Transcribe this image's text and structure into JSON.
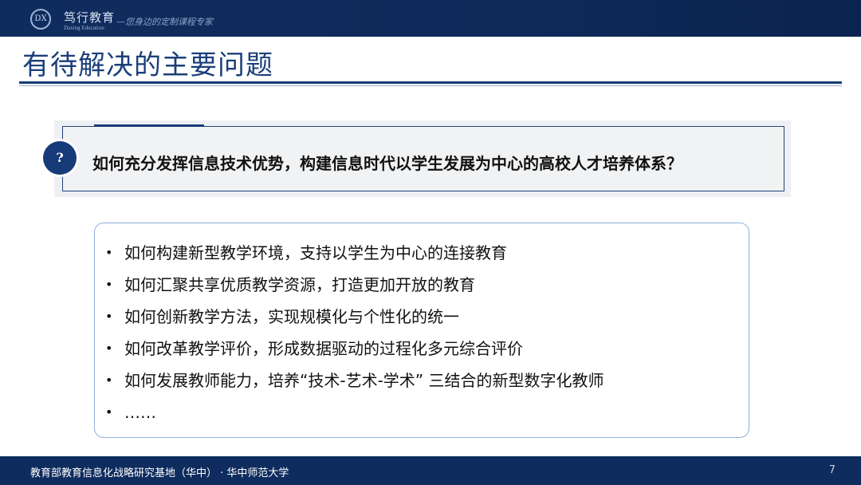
{
  "header": {
    "logo_mark": "DX",
    "brand_name": "笃行教育",
    "brand_english": "Daxing Education",
    "slogan": "—您身边的定制课程专家"
  },
  "slide": {
    "title": "有待解决的主要问题",
    "question_badge": "?",
    "question": "如何充分发挥信息技术优势，构建信息时代以学生发展为中心的高校人才培养体系？",
    "bullet_symbol": "•",
    "items": [
      "如何构建新型教学环境，支持以学生为中心的连接教育",
      "如何汇聚共享优质教学资源，打造更加开放的教育",
      "如何创新教学方法，实现规模化与个性化的统一",
      "如何改革教学评价，形成数据驱动的过程化多元综合评价",
      "如何发展教师能力，培养“技术-艺术-学术”  三结合的新型数字化教师",
      "……"
    ]
  },
  "footer": {
    "text": "教育部教育信息化战略研究基地（华中）  ·   华中师范大学",
    "page_number": "7"
  },
  "colors": {
    "navy": "#0f2c5e",
    "title_blue": "#1b3f7a",
    "list_border": "#8fb0da"
  }
}
